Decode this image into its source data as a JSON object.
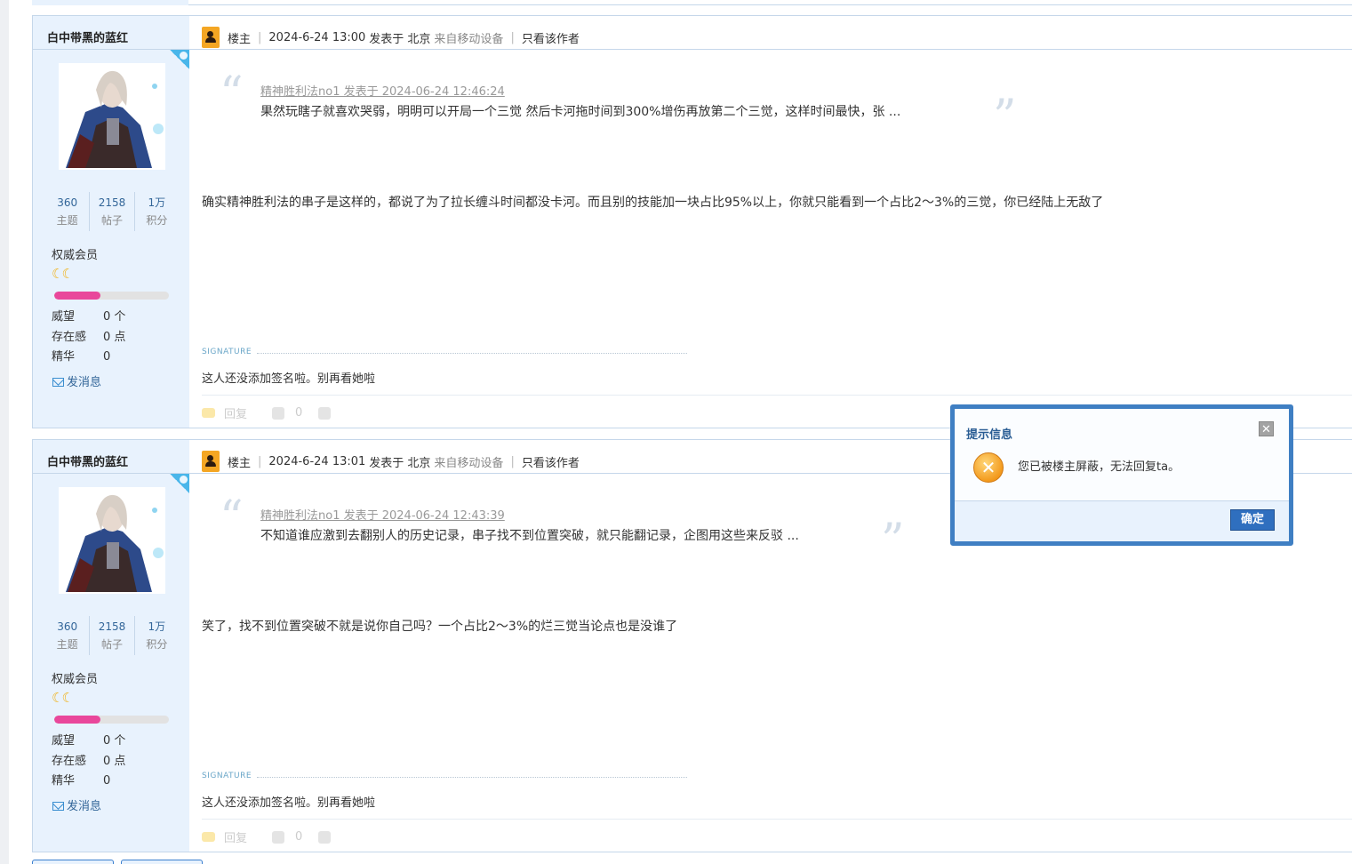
{
  "posts": [
    {
      "author": "白中带黑的蓝红",
      "stats": [
        {
          "num": "360",
          "label": "主题"
        },
        {
          "num": "2158",
          "label": "帖子"
        },
        {
          "num": "1万",
          "label": "积分"
        }
      ],
      "group": "权威会员",
      "moons": "☾☾",
      "level_progress": 0.4,
      "info": [
        {
          "key": "威望",
          "value": "0 个"
        },
        {
          "key": "存在感",
          "value": "0 点"
        },
        {
          "key": "精华",
          "value": "0"
        }
      ],
      "send_message": "发消息",
      "floor_label": "楼主",
      "datetime": "2024-6-24 13:00",
      "posted_in": "发表于 北京",
      "device": "来自移动设备",
      "only_author": "只看该作者",
      "quote_meta": "精神胜利法no1 发表于 2024-06-24 12:46:24",
      "quote_text": "果然玩瞎子就喜欢哭弱，明明可以开局一个三觉 然后卡河拖时间到300%增伤再放第二个三觉，这样时间最快，张 ...",
      "body": "确实精神胜利法的串子是这样的，都说了为了拉长缠斗时间都没卡河。而且别的技能加一块占比95%以上，你就只能看到一个占比2～3%的三觉，你已经陆上无敌了",
      "signature_label": "SIGNATURE",
      "signature": "这人还没添加签名啦。别再看她啦",
      "reply_label": "回复",
      "like_count": "0"
    },
    {
      "author": "白中带黑的蓝红",
      "stats": [
        {
          "num": "360",
          "label": "主题"
        },
        {
          "num": "2158",
          "label": "帖子"
        },
        {
          "num": "1万",
          "label": "积分"
        }
      ],
      "group": "权威会员",
      "moons": "☾☾",
      "level_progress": 0.4,
      "info": [
        {
          "key": "威望",
          "value": "0 个"
        },
        {
          "key": "存在感",
          "value": "0 点"
        },
        {
          "key": "精华",
          "value": "0"
        }
      ],
      "send_message": "发消息",
      "floor_label": "楼主",
      "datetime": "2024-6-24 13:01",
      "posted_in": "发表于 北京",
      "device": "来自移动设备",
      "only_author": "只看该作者",
      "quote_meta": "精神胜利法no1 发表于 2024-06-24 12:43:39",
      "quote_text": "不知道谁应激到去翻别人的历史记录，串子找不到位置突破，就只能翻记录，企图用这些来反驳 ...",
      "body": "笑了，找不到位置突破不就是说你自己吗？一个占比2～3%的烂三觉当论点也是没谁了",
      "signature_label": "SIGNATURE",
      "signature": "这人还没添加签名啦。别再看她啦",
      "reply_label": "回复",
      "like_count": "0"
    }
  ],
  "dialog": {
    "title": "提示信息",
    "close": "✕",
    "message": "您已被楼主屏蔽，无法回复ta。",
    "error_icon": "✕",
    "ok_label": "确定"
  },
  "colors": {
    "sidebar_bg": "#e8f2fd",
    "border": "#c5d7ea",
    "link": "#336699",
    "progress": "#e9479b",
    "dialog_border": "#3f7fc3",
    "ok_button": "#2f6fbf"
  }
}
